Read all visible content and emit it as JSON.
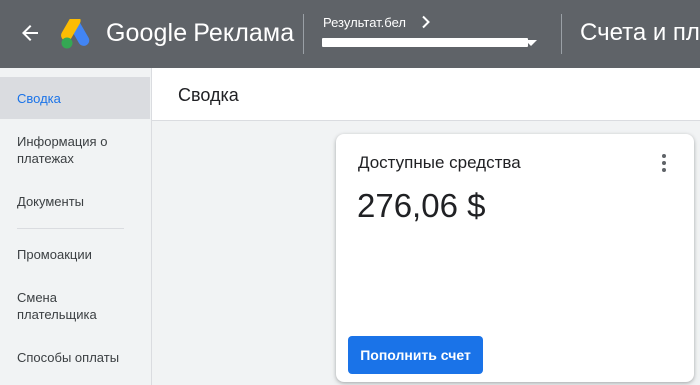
{
  "header": {
    "brand_google": "Google",
    "brand_product": "Реклама",
    "account_name": "Результат.бел",
    "section_title": "Счета и пла"
  },
  "sidebar": {
    "items": [
      {
        "label": "Сводка",
        "active": true
      },
      {
        "label": "Информация о платежах"
      },
      {
        "label": "Документы"
      },
      {
        "label": "Промоакции"
      },
      {
        "label": "Смена плательщика"
      },
      {
        "label": "Способы оплаты"
      }
    ]
  },
  "page": {
    "title": "Сводка"
  },
  "card": {
    "title": "Доступные средства",
    "amount": "276,06 $",
    "button_label": "Пополнить счет"
  },
  "colors": {
    "topbar": "#5f6368",
    "accent": "#1a73e8",
    "sidebar_bg": "#f1f3f4",
    "active_item_bg": "#dadce0"
  },
  "icons": [
    "arrow-back-icon",
    "google-ads-logo",
    "chevron-right-icon",
    "dropdown-arrow-icon",
    "more-vert-icon"
  ]
}
